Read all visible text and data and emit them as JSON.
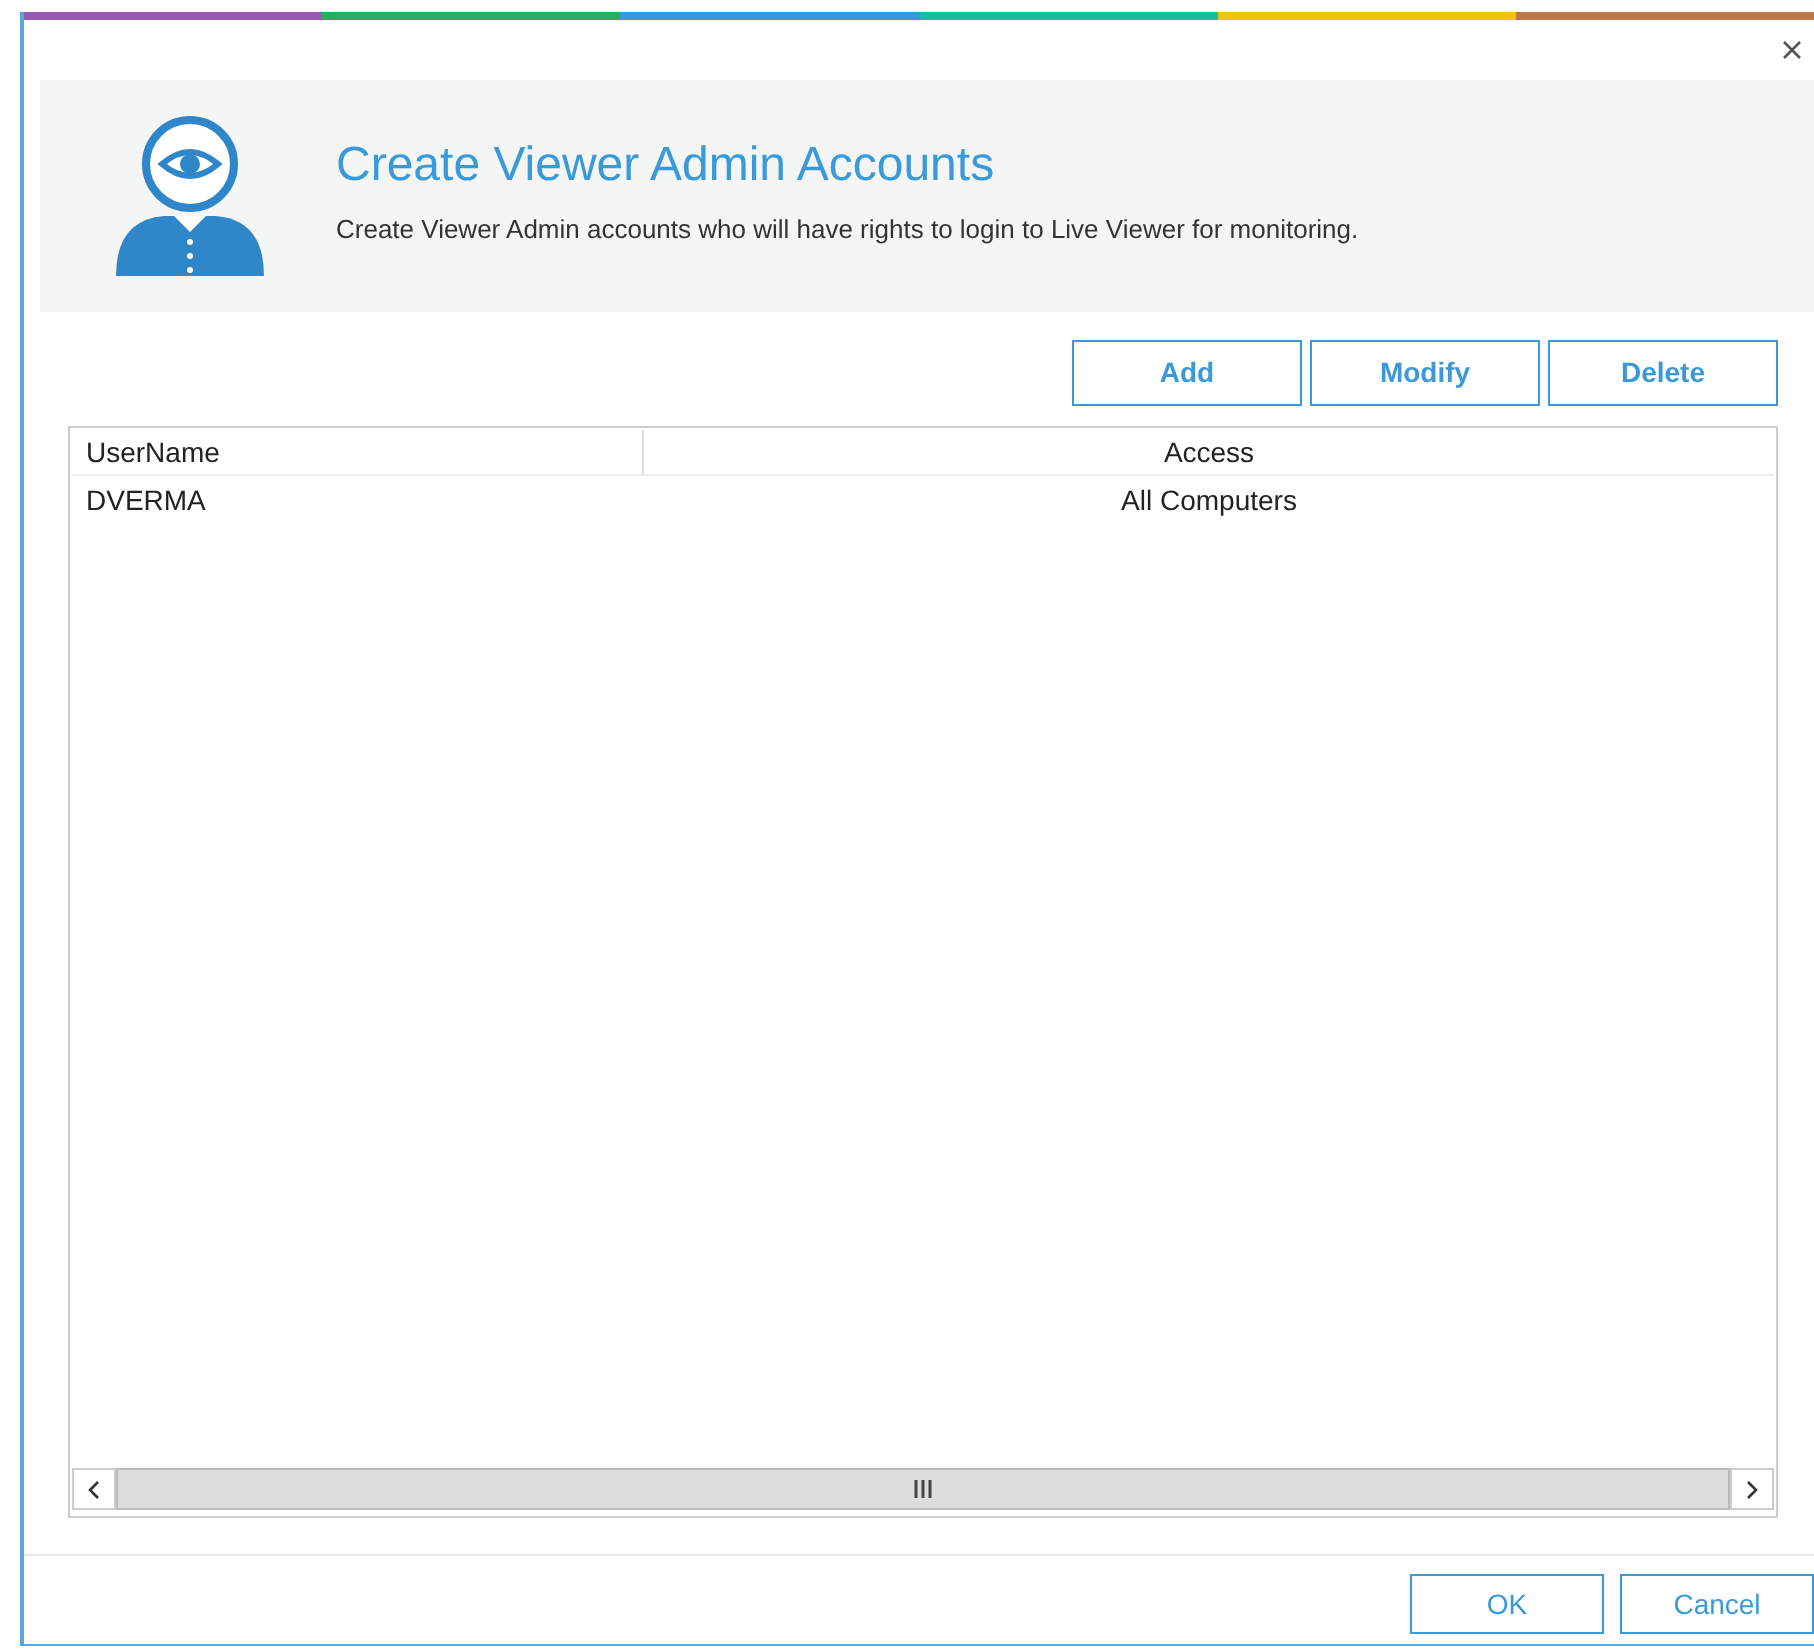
{
  "header": {
    "title": "Create Viewer Admin Accounts",
    "subtitle": "Create Viewer Admin accounts who will have rights to login to Live Viewer for monitoring."
  },
  "toolbar": [
    "Add",
    "Modify",
    "Delete"
  ],
  "table": {
    "columns": [
      "UserName",
      "Access"
    ],
    "rows": [
      [
        "DVERMA",
        "All Computers"
      ]
    ]
  },
  "buttons": [
    "OK",
    "Cancel"
  ]
}
